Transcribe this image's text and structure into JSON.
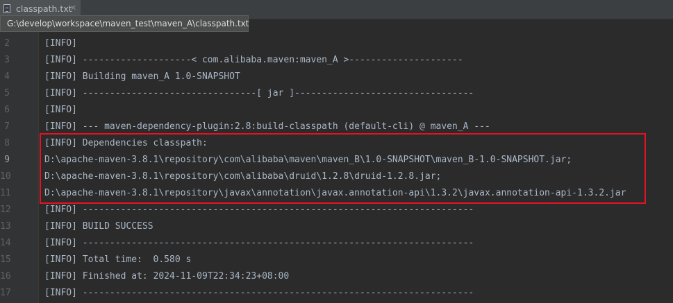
{
  "tab": {
    "label": "classpath.txt",
    "icon": "text-file-icon"
  },
  "tooltip": {
    "text": "G:\\develop\\workspace\\maven_test\\maven_A\\classpath.txt"
  },
  "editor": {
    "active_line": "9",
    "lines": [
      {
        "num": "2",
        "text": "[INFO]"
      },
      {
        "num": "3",
        "text": "[INFO] --------------------< com.alibaba.maven:maven_A >---------------------"
      },
      {
        "num": "4",
        "text": "[INFO] Building maven_A 1.0-SNAPSHOT"
      },
      {
        "num": "5",
        "text": "[INFO] --------------------------------[ jar ]---------------------------------"
      },
      {
        "num": "6",
        "text": "[INFO]"
      },
      {
        "num": "7",
        "text": "[INFO] --- maven-dependency-plugin:2.8:build-classpath (default-cli) @ maven_A ---"
      },
      {
        "num": "8",
        "text": "[INFO] Dependencies classpath:"
      },
      {
        "num": "9",
        "text": "D:\\apache-maven-3.8.1\\repository\\com\\alibaba\\maven\\maven_B\\1.0-SNAPSHOT\\maven_B-1.0-SNAPSHOT.jar;"
      },
      {
        "num": "10",
        "text": "D:\\apache-maven-3.8.1\\repository\\com\\alibaba\\druid\\1.2.8\\druid-1.2.8.jar;"
      },
      {
        "num": "11",
        "text": "D:\\apache-maven-3.8.1\\repository\\javax\\annotation\\javax.annotation-api\\1.3.2\\javax.annotation-api-1.3.2.jar"
      },
      {
        "num": "12",
        "text": "[INFO] ------------------------------------------------------------------------"
      },
      {
        "num": "13",
        "text": "[INFO] BUILD SUCCESS"
      },
      {
        "num": "14",
        "text": "[INFO] ------------------------------------------------------------------------"
      },
      {
        "num": "15",
        "text": "[INFO] Total time:  0.580 s"
      },
      {
        "num": "16",
        "text": "[INFO] Finished at: 2024-11-09T22:34:23+08:00"
      },
      {
        "num": "17",
        "text": "[INFO] ------------------------------------------------------------------------"
      }
    ]
  },
  "colors": {
    "editor_bg": "#2b2b2b",
    "text": "#a9b7c6",
    "highlight_border": "#e81123"
  }
}
